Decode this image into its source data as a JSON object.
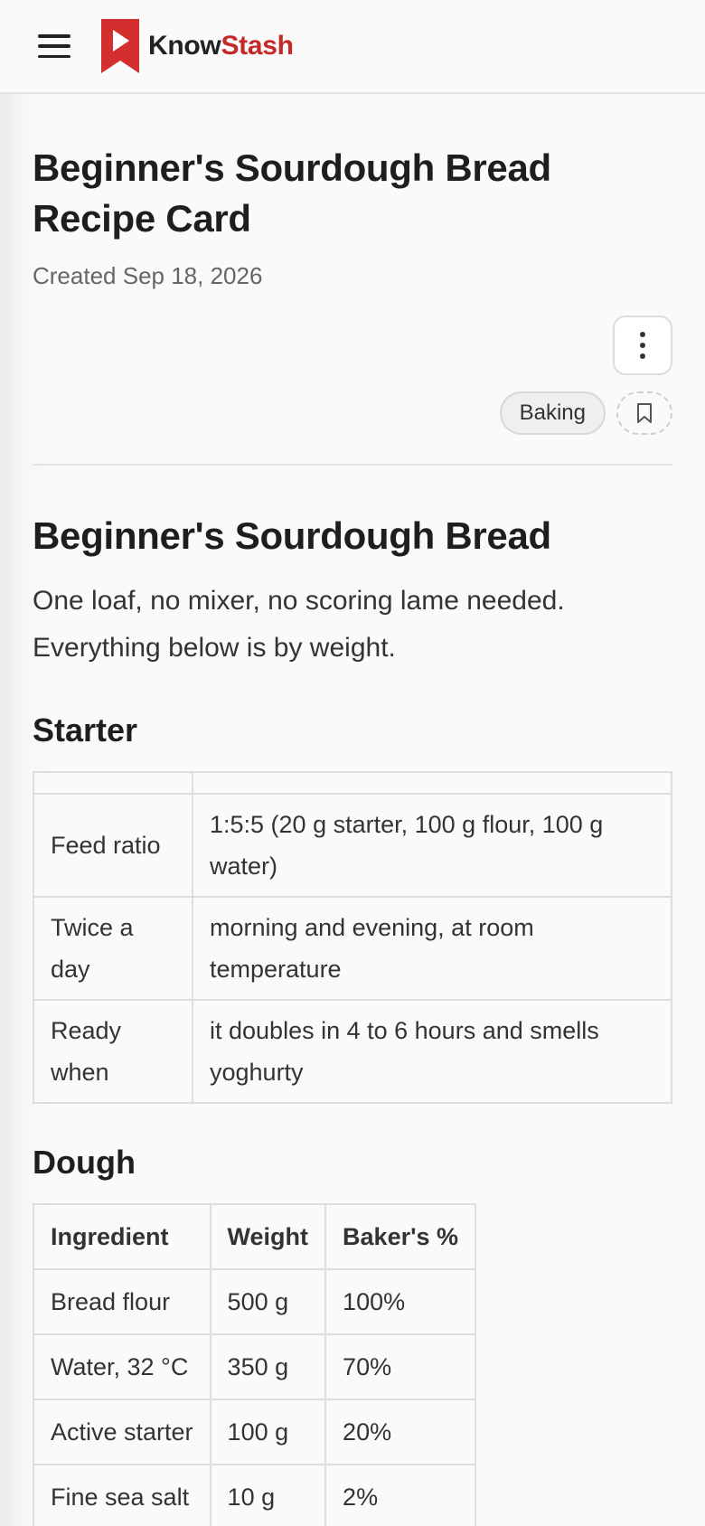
{
  "header": {
    "brand_part1": "Know",
    "brand_part2": "Stash",
    "brand_color": "#c62828",
    "menu_icon": "hamburger-menu-icon"
  },
  "page": {
    "title": "Beginner's Sourdough Bread Recipe Card",
    "created": "Created Sep 18, 2026",
    "more_icon": "more-vertical-icon",
    "tag": "Baking",
    "bookmark_icon": "bookmark-icon"
  },
  "content": {
    "heading": "Beginner's Sourdough Bread",
    "intro": "One loaf, no mixer, no scoring lame needed. Everything below is by weight.",
    "starter_heading": "Starter",
    "starter_rows": [
      {
        "k": "Feed ratio",
        "v": "1:5:5 (20 g starter, 100 g flour, 100 g water)"
      },
      {
        "k": "Twice a day",
        "v": "morning and evening, at room temperature"
      },
      {
        "k": "Ready when",
        "v": "it doubles in 4 to 6 hours and smells yoghurty"
      }
    ],
    "dough_heading": "Dough",
    "dough_headers": [
      "Ingredient",
      "Weight",
      "Baker's %"
    ],
    "dough_rows": [
      [
        "Bread flour",
        "500 g",
        "100%"
      ],
      [
        "Water, 32 °C",
        "350 g",
        "70%"
      ],
      [
        "Active starter",
        "100 g",
        "20%"
      ],
      [
        "Fine sea salt",
        "10 g",
        "2%"
      ]
    ]
  }
}
